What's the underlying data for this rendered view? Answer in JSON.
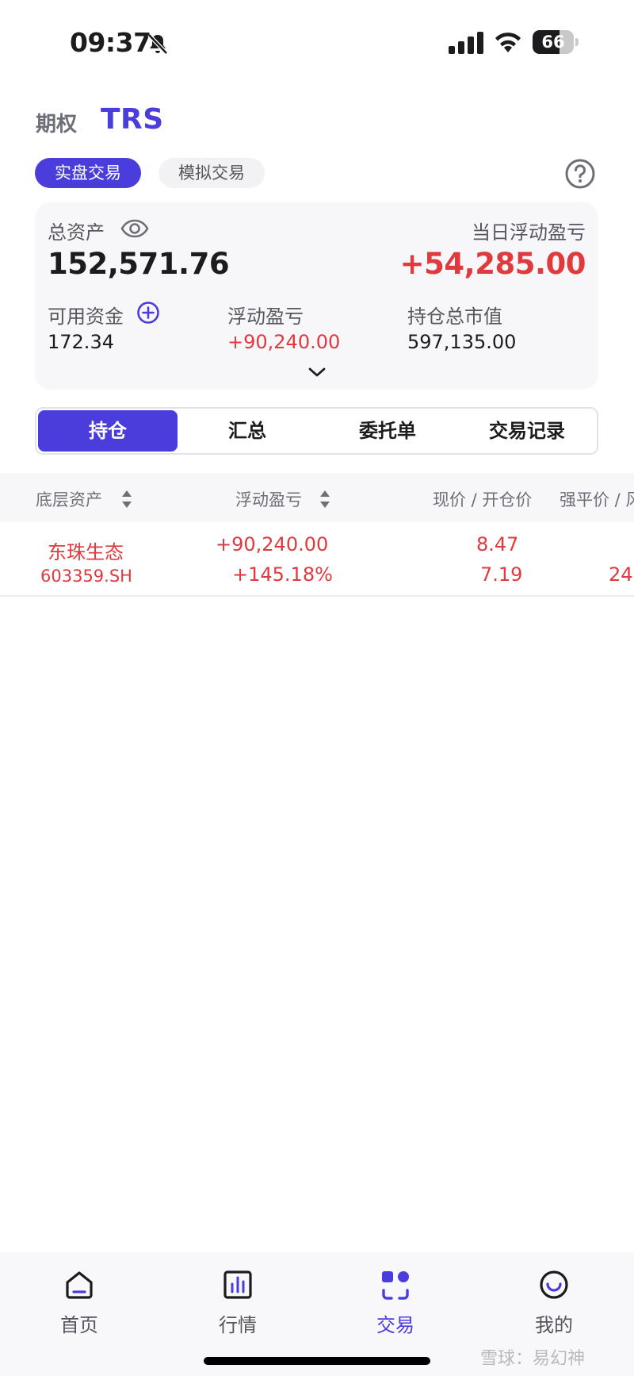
{
  "status_bar": {
    "time": "09:37",
    "battery": "66",
    "battery_level": 0.66
  },
  "header": {
    "tab_options": "期权",
    "tab_trs": "TRS"
  },
  "mode": {
    "real": "实盘交易",
    "simulated": "模拟交易"
  },
  "account": {
    "total_assets_label": "总资产",
    "total_assets_value": "152,571.76",
    "daily_pnl_label": "当日浮动盈亏",
    "daily_pnl_value": "+54,285.00",
    "available_label": "可用资金",
    "available_value": "172.34",
    "floating_pnl_label": "浮动盈亏",
    "floating_pnl_value": "+90,240.00",
    "market_value_label": "持仓总市值",
    "market_value_value": "597,135.00"
  },
  "tabs": [
    "持仓",
    "汇总",
    "委托单",
    "交易记录"
  ],
  "table": {
    "headers": [
      "底层资产",
      "浮动盈亏",
      "现价 / 开仓价",
      "强平价 / 风"
    ],
    "rows": [
      {
        "name": "东珠生态",
        "code": "603359.SH",
        "pnl": "+90,240.00",
        "pnl_pct": "+145.18%",
        "current_price": "8.47",
        "open_price": "7.19",
        "liquidation_partial": "24"
      }
    ]
  },
  "nav": [
    {
      "label": "首页",
      "icon": "home-icon"
    },
    {
      "label": "行情",
      "icon": "chart-icon"
    },
    {
      "label": "交易",
      "icon": "trade-icon"
    },
    {
      "label": "我的",
      "icon": "smile-icon"
    }
  ],
  "watermark": "雪球：易幻神",
  "colors": {
    "accent": "#4a3ddb",
    "up": "#e0393e"
  }
}
